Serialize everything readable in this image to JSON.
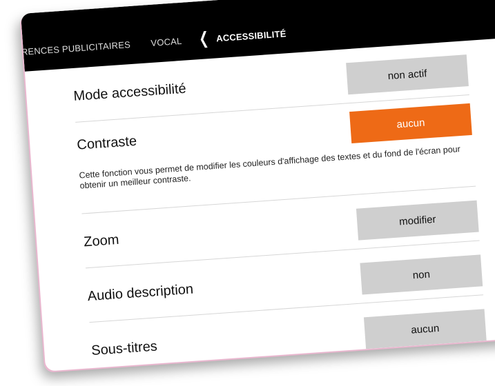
{
  "header": {
    "prev_crumb": "FÉRENCES PUBLICITAIRES",
    "vocal_crumb": "VOCAL",
    "current_crumb": "ACCESSIBILITÉ"
  },
  "settings": {
    "mode": {
      "label": "Mode accessibilité",
      "value": "non actif"
    },
    "contraste": {
      "label": "Contraste",
      "value": "aucun",
      "description": "Cette fonction vous permet de modifier les couleurs d'affichage des textes et du fond de l'écran pour obtenir un meilleur contraste."
    },
    "zoom": {
      "label": "Zoom",
      "value": "modifier"
    },
    "audio": {
      "label": "Audio description",
      "value": "non"
    },
    "soustitres": {
      "label": "Sous-titres",
      "value": "aucun"
    }
  },
  "colors": {
    "accent": "#ee6a16",
    "button": "#cfcfcf",
    "topbar": "#000000"
  }
}
